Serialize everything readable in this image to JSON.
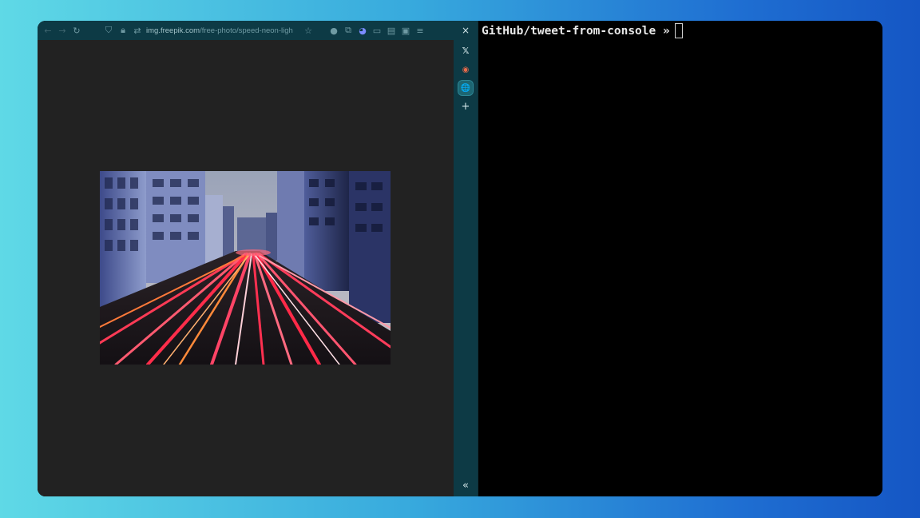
{
  "browser": {
    "url_host": "img.freepik.com",
    "url_path": "/free-photo/speed-neon-ligh",
    "toolbar_icons": [
      "back-icon",
      "forward-icon",
      "reload-icon",
      "shield-icon",
      "lock-icon",
      "tracking-icon",
      "bookmark-star-icon",
      "extension-icon",
      "puzzle-icon",
      "profile-icon",
      "container-icon",
      "sidebar-icon",
      "reader-icon",
      "menu-icon"
    ],
    "close_glyph": "×",
    "sidebar": {
      "items": [
        {
          "name": "x-icon",
          "glyph": "𝕏"
        },
        {
          "name": "chrome-icon",
          "glyph": "◉"
        },
        {
          "name": "globe-icon",
          "glyph": "🌐"
        },
        {
          "name": "add-icon",
          "glyph": "+"
        }
      ],
      "collapse_glyph": "«"
    },
    "image": {
      "subject": "city street with neon light trails"
    }
  },
  "terminal": {
    "prompt": "GitHub/tweet-from-console »"
  },
  "colors": {
    "toolbar": "#0d3a45",
    "viewport": "#222222",
    "terminal": "#000000"
  }
}
